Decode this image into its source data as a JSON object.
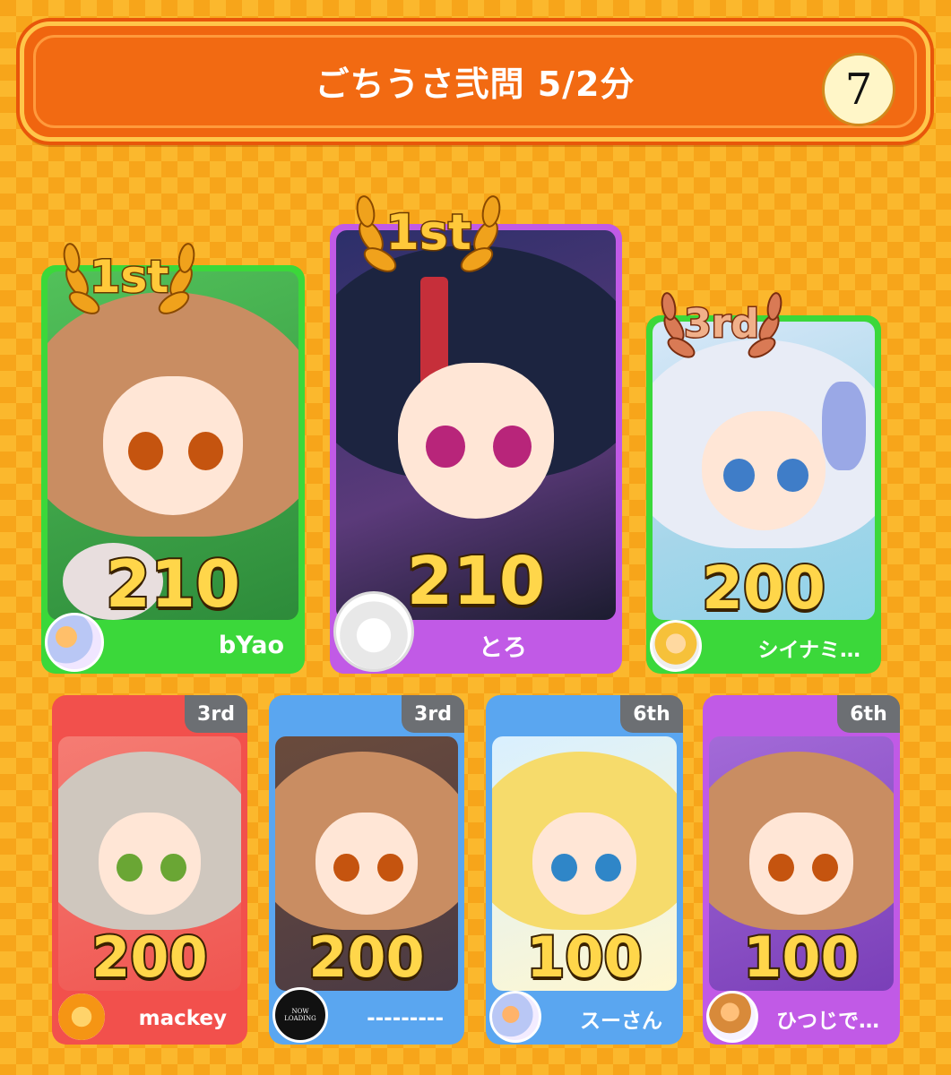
{
  "header": {
    "title": "ごちうさ弐問 5/2分",
    "round": "7"
  },
  "colors": {
    "green": "#3bd83a",
    "purple": "#c15ae6",
    "blue": "#5aa6f0",
    "red": "#f2504c",
    "gold": "#ffd64a"
  },
  "top_cards": [
    {
      "rank": "1st",
      "score": "210",
      "name": "bYao",
      "bar_color": "#3bd83a"
    },
    {
      "rank": "1st",
      "score": "210",
      "name": "とろ",
      "bar_color": "#c15ae6"
    },
    {
      "rank": "3rd",
      "score": "200",
      "name": "シイナミ…",
      "bar_color": "#3bd83a"
    }
  ],
  "bottom_cards": [
    {
      "rank": "3rd",
      "score": "200",
      "name": "mackey",
      "bar_color": "#f2504c"
    },
    {
      "rank": "3rd",
      "score": "200",
      "name": "---------",
      "bar_color": "#5aa6f0",
      "avatar_text": "NOW LOADING"
    },
    {
      "rank": "6th",
      "score": "100",
      "name": "スーさん",
      "bar_color": "#5aa6f0"
    },
    {
      "rank": "6th",
      "score": "100",
      "name": "ひつじで…",
      "bar_color": "#c15ae6"
    }
  ]
}
